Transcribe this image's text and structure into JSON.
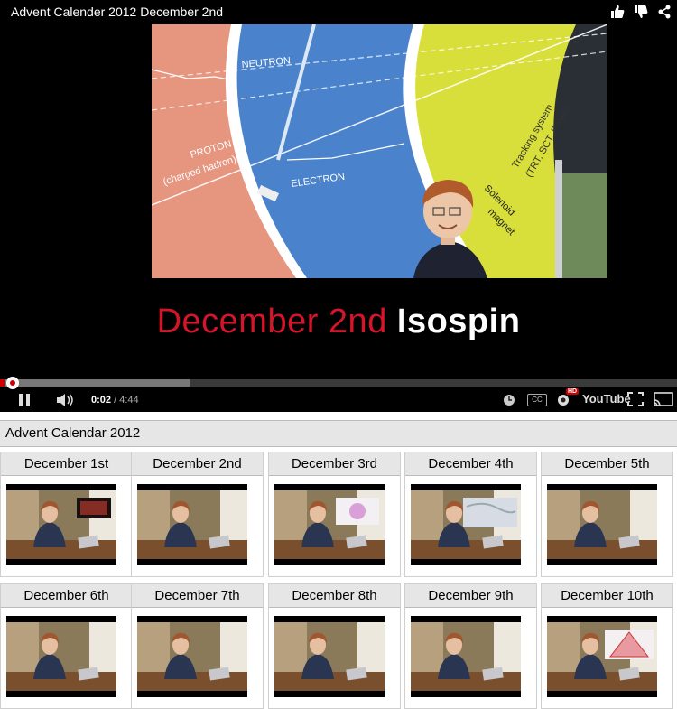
{
  "player": {
    "title": "Advent Calender 2012 December 2nd",
    "caption_red": "December  2nd",
    "caption_white": "Isospin",
    "frame_labels": {
      "neutron": "NEUTRON",
      "proton": "PROTON",
      "proton_sub": "(charged hadron)",
      "electron": "ELECTRON",
      "tracking": "Tracking system",
      "tracking_sub": "(TRT, SCT, Pixels)",
      "solenoid": "Solenoid",
      "magnet": "magnet"
    },
    "current_time": "0:02",
    "separator": " / ",
    "duration": "4:44",
    "progress_fraction": 0.007,
    "loaded_fraction": 0.28,
    "hd_badge": "HD",
    "cc_label": "CC",
    "brand": "YouTube",
    "colors": {
      "accent": "#cc0000",
      "caption_red": "#d4152a"
    }
  },
  "playlist": {
    "title": "Advent Calendar 2012",
    "items": [
      {
        "label": "December 1st",
        "inset": "dark"
      },
      {
        "label": "December 2nd",
        "inset": "none"
      },
      {
        "label": "December 3rd",
        "inset": "light"
      },
      {
        "label": "December 4th",
        "inset": "map"
      },
      {
        "label": "December 5th",
        "inset": "none"
      },
      {
        "label": "December 6th",
        "inset": "none"
      },
      {
        "label": "December 7th",
        "inset": "none"
      },
      {
        "label": "December 8th",
        "inset": "none"
      },
      {
        "label": "December 9th",
        "inset": "none"
      },
      {
        "label": "December 10th",
        "inset": "triangle"
      }
    ]
  }
}
